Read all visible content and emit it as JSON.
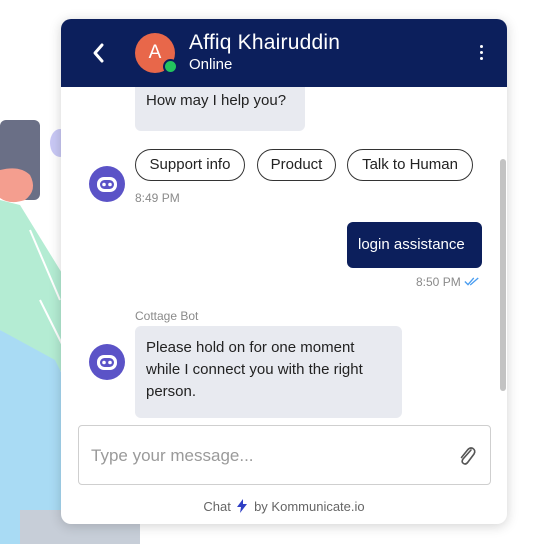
{
  "header": {
    "avatar_letter": "A",
    "agent_name": "Affiq Khairuddin",
    "agent_status": "Online"
  },
  "messages": {
    "greeting_partial": "How may I help you?",
    "quick_replies": [
      "Support info",
      "Product",
      "Talk to Human"
    ],
    "quick_replies_time": "8:49 PM",
    "user_message": "login assistance",
    "user_message_time": "8:50 PM",
    "bot_sender": "Cottage Bot",
    "bot_reply_lines": [
      "Please hold on for one moment",
      "while I connect you with the right",
      "person."
    ]
  },
  "composer": {
    "placeholder": "Type your message..."
  },
  "footer": {
    "prefix": "Chat",
    "suffix": "by Kommunicate.io"
  },
  "colors": {
    "header_bg": "#0c1f5c",
    "avatar_bg": "#e8674a",
    "online": "#23c55e",
    "bot_icon": "#5b53c7",
    "read_tick": "#4a9df0",
    "bolt": "#2f3fc4"
  },
  "icons": {
    "back": "chevron-left-icon",
    "menu": "more-vertical-icon",
    "attach": "paperclip-icon",
    "bot": "robot-icon",
    "read": "double-check-icon",
    "bolt": "lightning-icon"
  }
}
